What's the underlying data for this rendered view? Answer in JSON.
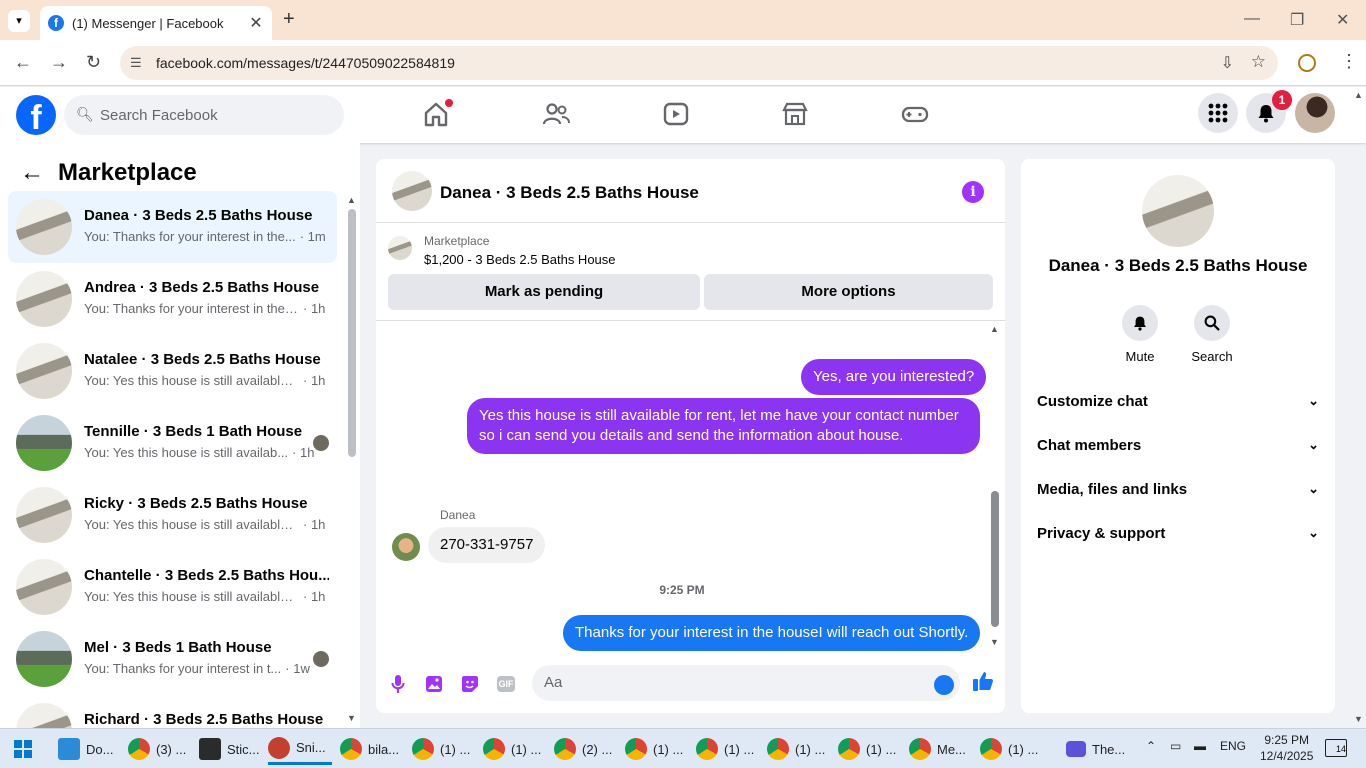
{
  "browser": {
    "tab_title": "(1) Messenger | Facebook",
    "url": "facebook.com/messages/t/24470509022584819",
    "new_tab": "+",
    "close_tab": "✕"
  },
  "fb": {
    "search_placeholder": "Search Facebook",
    "notification_count": "1"
  },
  "sidebar": {
    "title": "Marketplace",
    "conversations": [
      {
        "name": "Danea · 3 Beds 2.5 Baths House",
        "preview": "You: Thanks for your interest in the...",
        "time": "· 1m"
      },
      {
        "name": "Andrea · 3 Beds 2.5 Baths House",
        "preview": "You: Thanks for your interest in the ...",
        "time": "· 1h"
      },
      {
        "name": "Natalee · 3 Beds 2.5 Baths House",
        "preview": "You: Yes this house is still available f...",
        "time": "· 1h"
      },
      {
        "name": "Tennille · 3 Beds 1 Bath House",
        "preview": "You: Yes this house is still availab...",
        "time": "· 1h"
      },
      {
        "name": "Ricky · 3 Beds 2.5 Baths House",
        "preview": "You: Yes this house is still available f...",
        "time": "· 1h"
      },
      {
        "name": "Chantelle · 3 Beds 2.5 Baths Hou...",
        "preview": "You: Yes this house is still available f...",
        "time": "· 1h"
      },
      {
        "name": "Mel · 3 Beds 1 Bath House",
        "preview": "You: Thanks for your interest in t...",
        "time": "· 1w"
      },
      {
        "name": "Richard · 3 Beds 2.5 Baths House",
        "preview": "",
        "time": ""
      }
    ]
  },
  "chat": {
    "title": "Danea · 3 Beds 2.5 Baths House",
    "marketplace_label": "Marketplace",
    "listing": "$1,200 - 3 Beds 2.5 Baths House",
    "mark_pending": "Mark as pending",
    "more_options": "More options",
    "messages": [
      {
        "text": "Yes, are you interested?"
      },
      {
        "text": "Yes this house is still available for rent, let me have your contact number so i can send you details and send the information about house."
      },
      {
        "sender": "Danea",
        "text": "270-331-9757"
      },
      {
        "text": "Thanks for your interest in the houseI will reach out Shortly."
      }
    ],
    "time_separator": "9:25 PM",
    "composer_placeholder": "Aa",
    "gif_label": "GIF"
  },
  "details": {
    "name": "Danea · 3 Beds 2.5 Baths House",
    "mute": "Mute",
    "search": "Search",
    "sections": [
      "Customize chat",
      "Chat members",
      "Media, files and links",
      "Privacy & support"
    ]
  },
  "taskbar": {
    "items": [
      "Do...",
      "(3) ...",
      "Stic...",
      "Sni...",
      "bila...",
      "(1) ...",
      "(1) ...",
      "(2) ...",
      "(1) ...",
      "(1) ...",
      "(1) ...",
      "(1) ...",
      "Me...",
      "(1) ..."
    ],
    "zoom_item": "The...",
    "lang": "ENG",
    "time": "9:25 PM",
    "date": "12/4/2025",
    "notifications": "14"
  },
  "colors": {
    "fb_blue": "#0866ff",
    "purple_bubble": "#8b35f2",
    "blue_bubble": "#1877f2",
    "accent_purple": "#a033ff"
  }
}
